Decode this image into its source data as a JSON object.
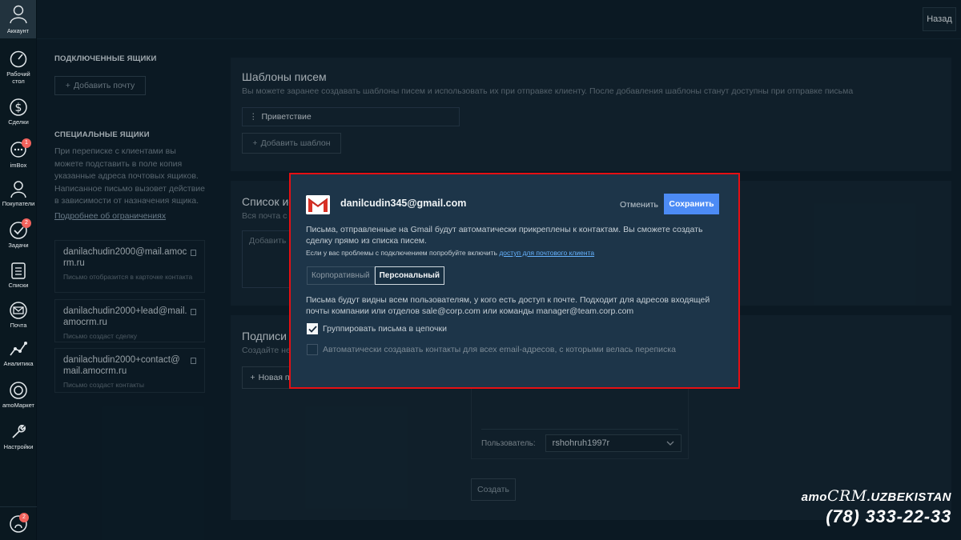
{
  "sidebar": {
    "account_label": "Аккаунт",
    "items": [
      {
        "label": "Рабочий стол",
        "icon": "dashboard-icon"
      },
      {
        "label": "Сделки",
        "icon": "dollar-icon"
      },
      {
        "label": "imBox",
        "icon": "chat-icon",
        "badge": "1"
      },
      {
        "label": "Покупатели",
        "icon": "customers-icon"
      },
      {
        "label": "Задачи",
        "icon": "tasks-icon",
        "badge": "2"
      },
      {
        "label": "Списки",
        "icon": "lists-icon"
      },
      {
        "label": "Почта",
        "icon": "mail-icon"
      },
      {
        "label": "Аналитика",
        "icon": "analytics-icon"
      },
      {
        "label": "amoМаркет",
        "icon": "market-icon"
      },
      {
        "label": "Настройки",
        "icon": "settings-icon"
      }
    ],
    "notifications_badge": "2"
  },
  "header": {
    "back_label": "Назад"
  },
  "left": {
    "connected_title": "ПОДКЛЮЧЕННЫЕ ЯЩИКИ",
    "add_mail_label": "Добавить почту",
    "special_title": "СПЕЦИАЛЬНЫЕ ЯЩИКИ",
    "special_desc": "При переписке с клиентами вы можете подставить в поле копия указанные адреса почтовых ящиков. Написанное письмо вызовет действие в зависимости от назначения ящика.",
    "limits_link": "Подробнее об ограничениях",
    "mailboxes": [
      {
        "email": "danilachudin2000@mail.amocrm.ru",
        "note": "Письмо отобразится в карточке контакта"
      },
      {
        "email": "danilachudin2000+lead@mail.amocrm.ru",
        "note": "Письмо создаст сделку"
      },
      {
        "email": "danilachudin2000+contact@mail.amocrm.ru",
        "note": "Письмо создаст контакты"
      }
    ]
  },
  "templates": {
    "title": "Шаблоны писем",
    "subtitle": "Вы можете заранее создавать шаблоны писем и использовать их при отправке клиенту. После добавления шаблоны станут доступны при отправке письма",
    "items": [
      "Приветствие"
    ],
    "add_label": "Добавить шаблон"
  },
  "lists": {
    "title_partial": "Список ис",
    "subtitle_partial": "Вся почта с",
    "add_placeholder_partial": "Добавить"
  },
  "signatures": {
    "title": "Подписи",
    "subtitle_partial": "Создайте не",
    "new_partial": "Новая п",
    "user_label": "Пользователь:",
    "user_value": "rshohruh1997r",
    "create_label": "Создать"
  },
  "modal": {
    "email": "danilcudin345@gmail.com",
    "cancel_label": "Отменить",
    "save_label": "Сохранить",
    "text1": "Письма, отправленные на Gmail будут автоматически прикреплены к контактам. Вы сможете создать сделку прямо из списка писем.",
    "hint_prefix": "Если у вас проблемы с подключением попробуйте включить",
    "hint_link": "доступ для почтового клиента",
    "tabs": [
      {
        "label": "Корпоративный",
        "active": false
      },
      {
        "label": "Персональный",
        "active": true
      }
    ],
    "text2": "Письма будут видны всем пользователям, у кого есть доступ к почте. Подходит для адресов входящей почты компании или отделов sale@corp.com или команды manager@team.corp.com",
    "group_label": "Группировать письма в цепочки",
    "group_checked": true,
    "autocreate_label": "Автоматически создавать контакты для всех email-адресов, с которыми велась переписка",
    "autocreate_checked": false
  },
  "watermark": {
    "brand_prefix": "amo",
    "brand_crm": "CRM",
    "brand_suffix": ".UZBEKISTAN",
    "phone": "(78) 333-22-33"
  },
  "colors": {
    "accent": "#4c8bf5",
    "badge": "#f2625c",
    "highlight_border": "#e60f13",
    "modal_bg": "#1d3549",
    "page_bg": "#0d1d28"
  }
}
